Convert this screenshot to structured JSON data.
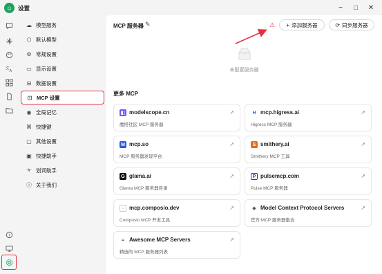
{
  "app": {
    "title": "设置"
  },
  "window_controls": {
    "minimize": "−",
    "maximize": "□",
    "close": "✕"
  },
  "settings_nav": [
    {
      "label": "模型服务",
      "icon": "cloud-icon"
    },
    {
      "label": "默认模型",
      "icon": "cube-icon"
    },
    {
      "label": "常规设置",
      "icon": "sliders-icon"
    },
    {
      "label": "显示设置",
      "icon": "monitor-icon"
    },
    {
      "label": "数据设置",
      "icon": "database-icon"
    },
    {
      "label": "MCP 设置",
      "icon": "server-icon",
      "active": true
    },
    {
      "label": "全局记忆",
      "icon": "memory-icon"
    },
    {
      "label": "快捷键",
      "icon": "command-icon"
    },
    {
      "label": "其他设置",
      "icon": "more-settings-icon"
    },
    {
      "label": "快捷助手",
      "icon": "quick-assistant-icon"
    },
    {
      "label": "划词助手",
      "icon": "text-select-icon"
    },
    {
      "label": "关于我们",
      "icon": "info-icon"
    }
  ],
  "header": {
    "title": "MCP 服务器",
    "add_button": "添加服务器",
    "sync_button": "同步服务器"
  },
  "empty_state": {
    "text": "未配置服务器"
  },
  "more_mcp": {
    "title": "更多 MCP",
    "cards": [
      {
        "name": "modelscope.cn",
        "desc": "魔搭社区 MCP 服务器",
        "logo_color": "#6b5cf6",
        "logo": "◧"
      },
      {
        "name": "mcp.higress.ai",
        "desc": "Higress MCP 服务器",
        "logo_color": "#3b6cf0",
        "logo": "H"
      },
      {
        "name": "mcp.so",
        "desc": "MCP 服务器发现平台",
        "logo_color": "#2a5bd7",
        "logo": "M"
      },
      {
        "name": "smithery.ai",
        "desc": "Smithery MCP 工具",
        "logo_color": "#e56a1c",
        "logo": "S"
      },
      {
        "name": "glama.ai",
        "desc": "Glama MCP 服务器目录",
        "logo_color": "#111111",
        "logo": "G"
      },
      {
        "name": "pulsemcp.com",
        "desc": "Pulse MCP 服务器",
        "logo_color": "#2d3a8c",
        "logo": "P"
      },
      {
        "name": "mcp.composio.dev",
        "desc": "Composio MCP 开发工具",
        "logo_color": "#aaaaaa",
        "logo": "▫"
      },
      {
        "name": "Model Context Protocol Servers",
        "desc": "官方 MCP 服务器集合",
        "logo_color": "#555555",
        "logo": "◆"
      },
      {
        "name": "Awesome MCP Servers",
        "desc": "精选的 MCP 服务器列表",
        "logo_color": "#444444",
        "logo": "≈"
      }
    ]
  },
  "colors": {
    "accent": "#1fa15b",
    "highlight": "#e2343f"
  }
}
